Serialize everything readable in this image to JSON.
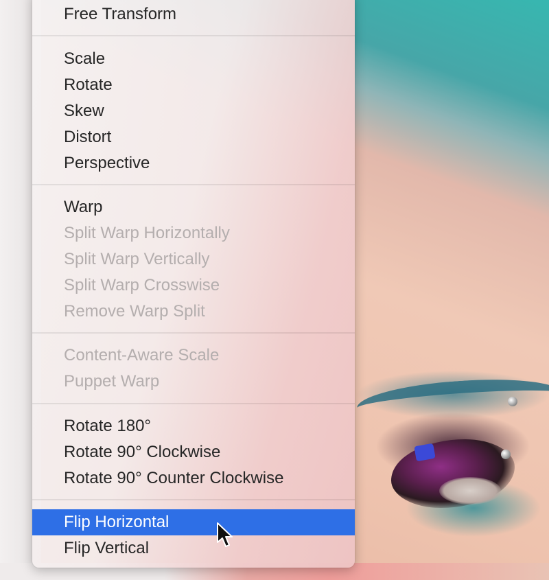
{
  "menu": {
    "groups": [
      [
        {
          "label": "Free Transform",
          "enabled": true
        }
      ],
      [
        {
          "label": "Scale",
          "enabled": true
        },
        {
          "label": "Rotate",
          "enabled": true
        },
        {
          "label": "Skew",
          "enabled": true
        },
        {
          "label": "Distort",
          "enabled": true
        },
        {
          "label": "Perspective",
          "enabled": true
        }
      ],
      [
        {
          "label": "Warp",
          "enabled": true
        },
        {
          "label": "Split Warp Horizontally",
          "enabled": false
        },
        {
          "label": "Split Warp Vertically",
          "enabled": false
        },
        {
          "label": "Split Warp Crosswise",
          "enabled": false
        },
        {
          "label": "Remove Warp Split",
          "enabled": false
        }
      ],
      [
        {
          "label": "Content-Aware Scale",
          "enabled": false
        },
        {
          "label": "Puppet Warp",
          "enabled": false
        }
      ],
      [
        {
          "label": "Rotate 180°",
          "enabled": true
        },
        {
          "label": "Rotate 90° Clockwise",
          "enabled": true
        },
        {
          "label": "Rotate 90° Counter Clockwise",
          "enabled": true
        }
      ],
      [
        {
          "label": "Flip Horizontal",
          "enabled": true,
          "selected": true
        },
        {
          "label": "Flip Vertical",
          "enabled": true
        }
      ]
    ],
    "selection_color": "#2e6fe6"
  },
  "cursor": {
    "icon": "arrow-pointer-icon"
  }
}
